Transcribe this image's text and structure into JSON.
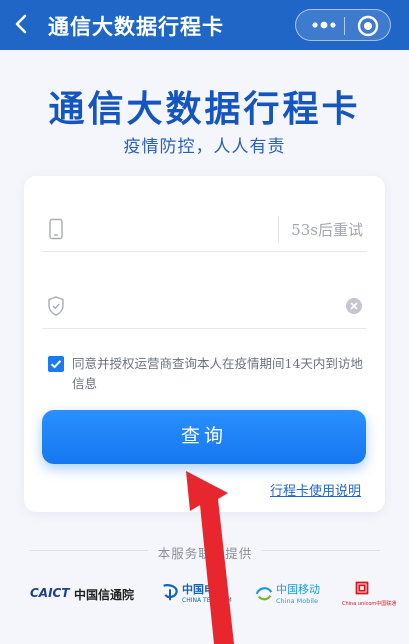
{
  "header": {
    "title": "通信大数据行程卡",
    "back_icon": "chevron-left-icon",
    "more_icon": "more-dots-icon",
    "close_icon": "target-circle-icon"
  },
  "hero": {
    "title": "通信大数据行程卡",
    "subtitle": "疫情防控，人人有责"
  },
  "form": {
    "phone": {
      "value": "",
      "placeholder": "",
      "icon": "phone-icon",
      "resend_label": "53s后重试"
    },
    "code": {
      "value": "",
      "placeholder": "",
      "icon": "shield-check-icon",
      "clear_icon": "clear-icon"
    },
    "consent": {
      "checked": true,
      "text": "同意并授权运营商查询本人在疫情期间14天内到访地信息"
    },
    "submit_label": "查询",
    "help_link": "行程卡使用说明"
  },
  "footer": {
    "provided_by": "本服务联合提供",
    "partners": [
      {
        "name": "CAICT",
        "label": "中国信通院"
      },
      {
        "name": "中国电信",
        "label": "CHINA TELECOM"
      },
      {
        "name": "中国移动",
        "label": "China Mobile"
      },
      {
        "name": "China unicom中国联通",
        "label": ""
      }
    ]
  },
  "colors": {
    "header_bg": "#1f66c6",
    "accent": "#1677ef",
    "annotation_arrow": "#e8262d"
  }
}
